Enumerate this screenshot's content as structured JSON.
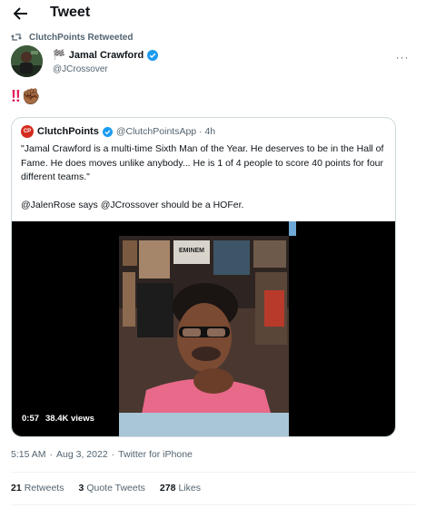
{
  "header": {
    "title": "Tweet"
  },
  "retweet": {
    "label": "ClutchPoints Retweeted"
  },
  "author": {
    "flag": "🏁",
    "name": "Jamal Crawford",
    "handle": "@JCrossover"
  },
  "tweet": {
    "text_marks": "‼",
    "emoji": "✊🏾"
  },
  "quote": {
    "avatar_text": "CP",
    "name": "ClutchPoints",
    "meta": "@ClutchPointsApp · 4h",
    "paragraph1": "\"Jamal Crawford is a multi-time Sixth Man of the Year. He deserves to be in the Hall of Fame. He does moves unlike anybody... He is 1 of 4 people to score 40 points for four different teams.\"",
    "paragraph2": "@JalenRose says @JCrossover should be a HOFer.",
    "video": {
      "duration": "0:57",
      "views": "38.4K views",
      "poster_text": "EMINEM"
    }
  },
  "timestamp": {
    "time": "5:15 AM",
    "date": "Aug 3, 2022",
    "source": "Twitter for iPhone",
    "sep": "·"
  },
  "stats": {
    "retweets_count": "21",
    "retweets_label": "Retweets",
    "quotes_count": "3",
    "quotes_label": "Quote Tweets",
    "likes_count": "278",
    "likes_label": "Likes"
  },
  "colors": {
    "accent": "#1d9bf0",
    "bang": "#e0245e",
    "muted": "#536471"
  }
}
